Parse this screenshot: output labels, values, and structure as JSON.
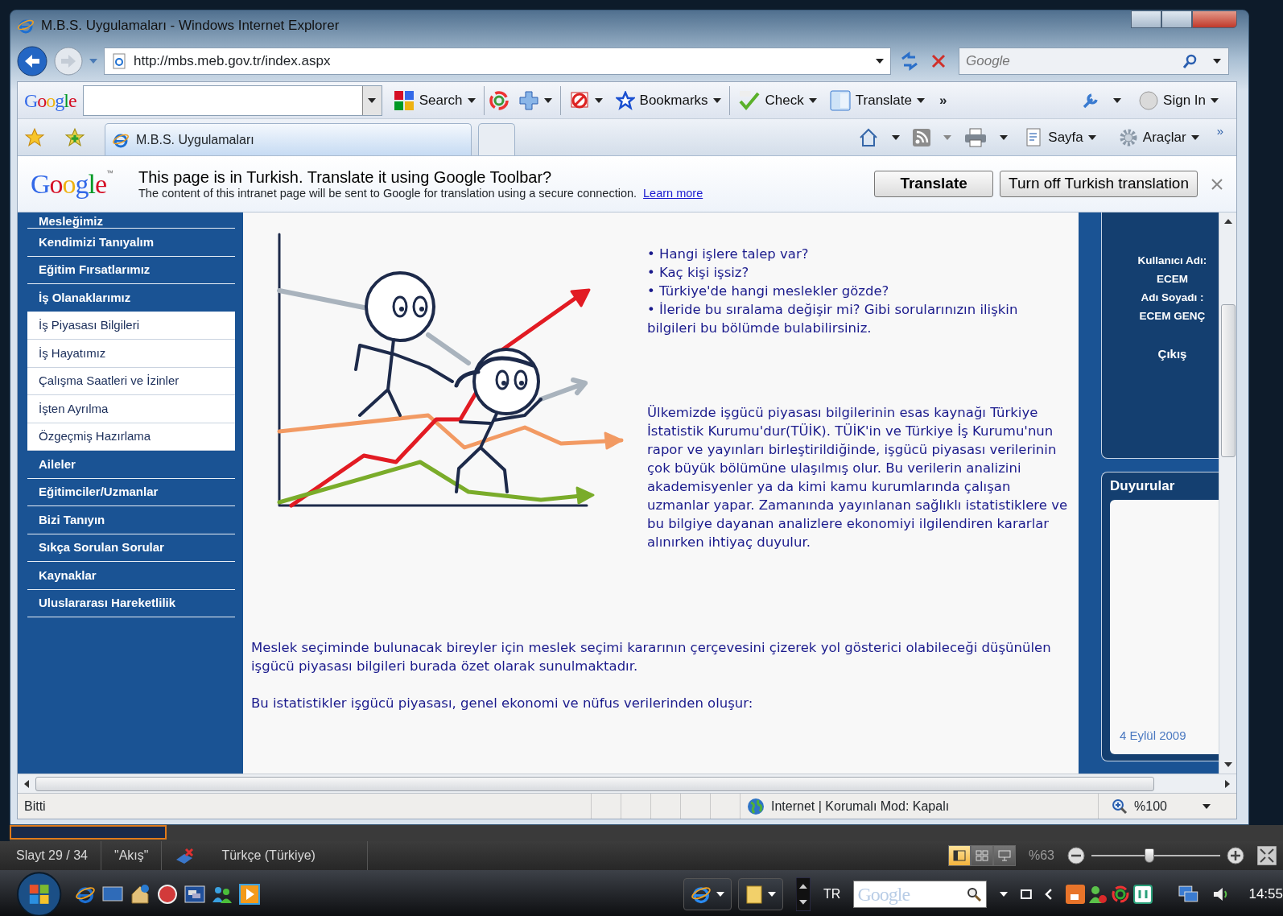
{
  "window": {
    "title": "M.B.S. Uygulamaları - Windows Internet Explorer"
  },
  "address_bar": {
    "url": "http://mbs.meb.gov.tr/index.aspx"
  },
  "search_box": {
    "placeholder": "Google"
  },
  "google_toolbar": {
    "logo": "Google",
    "items": [
      {
        "label": "Search"
      },
      {
        "label": "Bookmarks"
      },
      {
        "label": "Check"
      },
      {
        "label": "Translate"
      }
    ],
    "more": "»",
    "sign_in": "Sign In"
  },
  "tabs": [
    {
      "label": "M.B.S. Uygulamaları",
      "selected": true
    }
  ],
  "command_bar": {
    "items": [
      "Sayfa",
      "Araçlar"
    ],
    "more": "»"
  },
  "translate_bar": {
    "logo": "Google",
    "trademark": "™",
    "title": "This page is in Turkish.  Translate it using Google Toolbar?",
    "message": "The content of this intranet page will be sent to Google for translation using a secure connection.",
    "link": "Learn more",
    "buttons": [
      "Translate",
      "Turn off Turkish translation"
    ]
  },
  "sidebar": {
    "items": [
      {
        "label": "Mesleğimiz",
        "kind": "main"
      },
      {
        "label": "Kendimizi Tanıyalım",
        "kind": "main"
      },
      {
        "label": "Eğitim Fırsatlarımız",
        "kind": "main"
      },
      {
        "label": "İş Olanaklarımız",
        "kind": "main"
      },
      {
        "label": "İş Piyasası Bilgileri",
        "kind": "sub"
      },
      {
        "label": "İş Hayatımız",
        "kind": "sub"
      },
      {
        "label": "Çalışma Saatleri ve İzinler",
        "kind": "sub"
      },
      {
        "label": "İşten Ayrılma",
        "kind": "sub"
      },
      {
        "label": "Özgeçmiş Hazırlama",
        "kind": "sub"
      },
      {
        "label": "Aileler",
        "kind": "main"
      },
      {
        "label": "Eğitimciler/Uzmanlar",
        "kind": "main"
      },
      {
        "label": "Bizi Tanıyın",
        "kind": "main"
      },
      {
        "label": "Sıkça Sorulan Sorular",
        "kind": "main"
      },
      {
        "label": "Kaynaklar",
        "kind": "main"
      },
      {
        "label": "Uluslararası Hareketlilik",
        "kind": "main"
      }
    ]
  },
  "content": {
    "questions": [
      "• Hangi işlere talep var?",
      "• Kaç kişi işsiz?",
      "• Türkiye'de hangi meslekler gözde?",
      "• İleride bu sıralama değişir mi? Gibi sorularınızın ilişkin bilgileri bu bölümde bulabilirsiniz."
    ],
    "intro_paragraph": "Ülkemizde işgücü piyasası bilgilerinin esas kaynağı Türkiye İstatistik Kurumu'dur(TÜİK). TÜİK'in ve Türkiye İş Kurumu'nun rapor ve yayınları birleştirildiğinde, işgücü piyasası verilerinin çok büyük bölümüne ulaşılmış olur. Bu verilerin analizini akademisyenler ya da kimi kamu kurumlarında çalışan uzmanlar yapar. Zamanında yayınlanan sağlıklı istatistiklere ve bu bilgiye dayanan analizlere ekonomiyi ilgilendiren kararlar alınırken ihtiyaç duyulur.",
    "paragraphs": [
      "Meslek seçiminde bulunacak bireyler için meslek seçimi kararının çerçevesini çizerek yol gösterici olabileceği düşünülen işgücü piyasası bilgileri burada özet olarak sunulmaktadır.",
      "Bu istatistikler işgücü piyasası, genel ekonomi ve nüfus verilerinden oluşur:"
    ]
  },
  "user_panel": {
    "username_label": "Kullanıcı Adı:",
    "username": "ECEM",
    "fullname_label": "Adı Soyadı :",
    "fullname": "ECEM GENÇ",
    "logout": "Çıkış"
  },
  "announcements": {
    "title": "Duyurular",
    "date": "4 Eylül 2009"
  },
  "status_bar": {
    "text": "Bitti",
    "zone": "Internet | Korumalı Mod: Kapalı",
    "zoom": "%100"
  },
  "powerpoint_status": {
    "slide": "Slayt 29 / 34",
    "theme": "\"Akış\"",
    "language": "Türkçe (Türkiye)",
    "view_buttons": [
      {
        "selected": true
      },
      {
        "selected": false
      },
      {
        "selected": false
      }
    ],
    "zoom": "%63",
    "zoom_slider": {
      "level": 0.45
    }
  },
  "taskbar": {
    "language": "TR",
    "search_placeholder": "Google",
    "clock": "14:55"
  }
}
